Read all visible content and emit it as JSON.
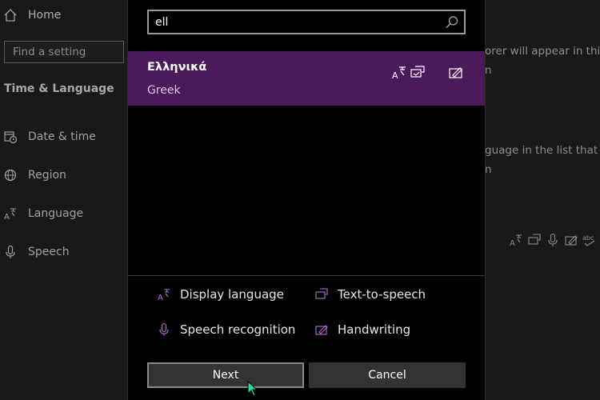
{
  "sidebar": {
    "home_label": "Home",
    "search_placeholder": "Find a setting",
    "section_title": "Time & Language",
    "items": [
      {
        "label": "Date & time",
        "icon": "calendar-clock-icon"
      },
      {
        "label": "Region",
        "icon": "globe-icon"
      },
      {
        "label": "Language",
        "icon": "language-icon"
      },
      {
        "label": "Speech",
        "icon": "microphone-icon"
      }
    ]
  },
  "background_text": {
    "line1": "orer will appear in this",
    "line2": "n",
    "line3": "guage in the list that",
    "line4": "n"
  },
  "dialog": {
    "search_value": "ell",
    "result": {
      "native_name": "Ελληνικά",
      "english_name": "Greek",
      "icons": [
        "display-language-icon",
        "text-to-speech-icon",
        "handwriting-icon"
      ]
    },
    "legend": {
      "display_language": "Display language",
      "text_to_speech": "Text-to-speech",
      "speech_recognition": "Speech recognition",
      "handwriting": "Handwriting"
    },
    "next_label": "Next",
    "cancel_label": "Cancel"
  },
  "colors": {
    "accent": "#4a1a5a",
    "icon_purple": "#b86fd8",
    "background": "#000000"
  }
}
